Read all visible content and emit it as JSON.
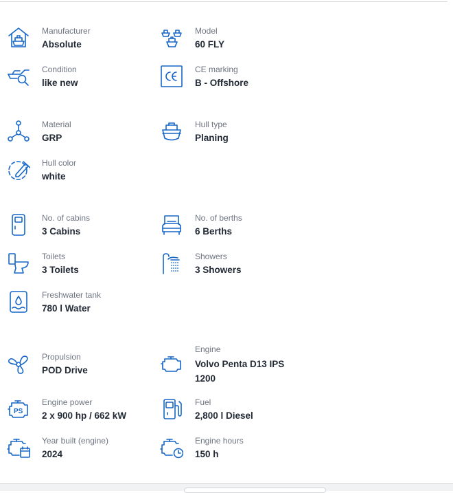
{
  "specs": {
    "manufacturer": {
      "label": "Manufacturer",
      "value": "Absolute",
      "icon": "house-boat-icon"
    },
    "model": {
      "label": "Model",
      "value": "60 FLY",
      "icon": "boats-icon"
    },
    "condition": {
      "label": "Condition",
      "value": "like new",
      "icon": "boat-magnifier-icon"
    },
    "ce_marking": {
      "label": "CE marking",
      "value": "B - Offshore",
      "icon": "ce-mark-icon"
    },
    "material": {
      "label": "Material",
      "value": "GRP",
      "icon": "molecule-icon"
    },
    "hull_type": {
      "label": "Hull type",
      "value": "Planing",
      "icon": "hull-icon"
    },
    "hull_color": {
      "label": "Hull color",
      "value": "white",
      "icon": "color-picker-icon"
    },
    "cabins": {
      "label": "No. of cabins",
      "value": "3 Cabins",
      "icon": "cabin-door-icon"
    },
    "berths": {
      "label": "No. of berths",
      "value": "6 Berths",
      "icon": "bed-icon"
    },
    "toilets": {
      "label": "Toilets",
      "value": "3 Toilets",
      "icon": "toilet-icon"
    },
    "showers": {
      "label": "Showers",
      "value": "3 Showers",
      "icon": "shower-icon"
    },
    "freshwater": {
      "label": "Freshwater tank",
      "value": "780 l Water",
      "icon": "water-tank-icon"
    },
    "propulsion": {
      "label": "Propulsion",
      "value": "POD Drive",
      "icon": "propeller-icon"
    },
    "engine": {
      "label": "Engine",
      "value": "Volvo Penta D13 IPS 1200",
      "icon": "engine-icon"
    },
    "engine_power": {
      "label": "Engine power",
      "value": "2 x 900 hp / 662 kW",
      "icon": "engine-ps-icon"
    },
    "fuel": {
      "label": "Fuel",
      "value": "2,800 l Diesel",
      "icon": "fuel-pump-icon"
    },
    "year_built_engine": {
      "label": "Year built (engine)",
      "value": "2024",
      "icon": "engine-calendar-icon"
    },
    "engine_hours": {
      "label": "Engine hours",
      "value": "150 h",
      "icon": "engine-clock-icon"
    }
  },
  "colors": {
    "accent": "#1667c8",
    "label": "#6d7480",
    "value": "#222a35"
  }
}
